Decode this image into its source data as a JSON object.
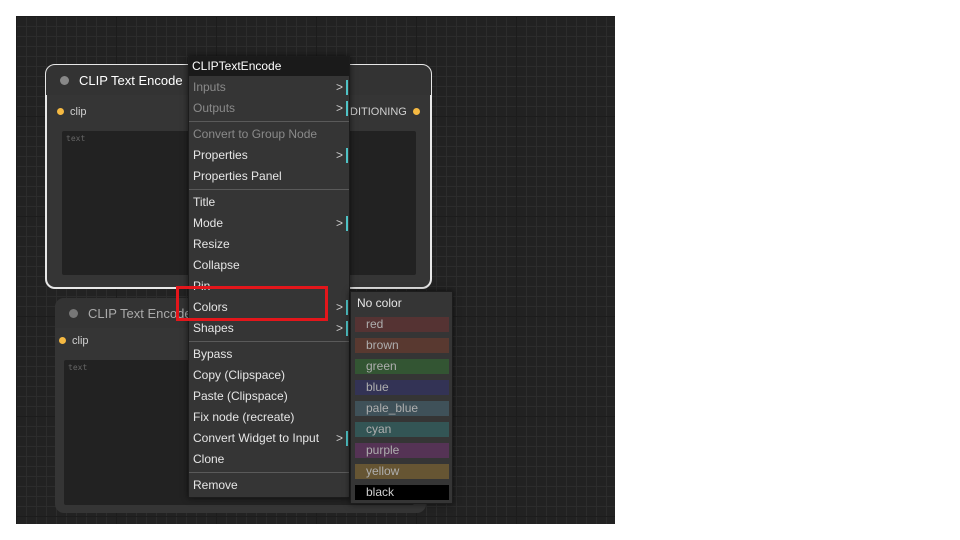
{
  "nodes": [
    {
      "title": "CLIP Text Encode",
      "input_label": "clip",
      "output_label": "DITIONING",
      "placeholder": "text"
    },
    {
      "title": "CLIP Text Encode",
      "input_label": "clip",
      "placeholder": "text"
    }
  ],
  "menu": {
    "title": "CLIPTextEncode",
    "items": [
      {
        "label": "Inputs"
      },
      {
        "label": "Outputs"
      },
      {
        "label": "Convert to Group Node"
      },
      {
        "label": "Properties"
      },
      {
        "label": "Properties Panel"
      },
      {
        "label": "Title"
      },
      {
        "label": "Mode"
      },
      {
        "label": "Resize"
      },
      {
        "label": "Collapse"
      },
      {
        "label": "Pin"
      },
      {
        "label": "Colors"
      },
      {
        "label": "Shapes"
      },
      {
        "label": "Bypass"
      },
      {
        "label": "Copy (Clipspace)"
      },
      {
        "label": "Paste (Clipspace)"
      },
      {
        "label": "Fix node (recreate)"
      },
      {
        "label": "Convert Widget to Input"
      },
      {
        "label": "Clone"
      },
      {
        "label": "Remove"
      }
    ],
    "submenu_arrow": ">"
  },
  "colors_menu": {
    "no_color": "No color",
    "swatches": [
      {
        "label": "red",
        "color": "#553333"
      },
      {
        "label": "brown",
        "color": "#593930"
      },
      {
        "label": "green",
        "color": "#335533"
      },
      {
        "label": "blue",
        "color": "#333355"
      },
      {
        "label": "pale_blue",
        "color": "#3f5159"
      },
      {
        "label": "cyan",
        "color": "#335555"
      },
      {
        "label": "purple",
        "color": "#553355"
      },
      {
        "label": "yellow",
        "color": "#665533"
      },
      {
        "label": "black",
        "color": "#000000"
      }
    ]
  }
}
